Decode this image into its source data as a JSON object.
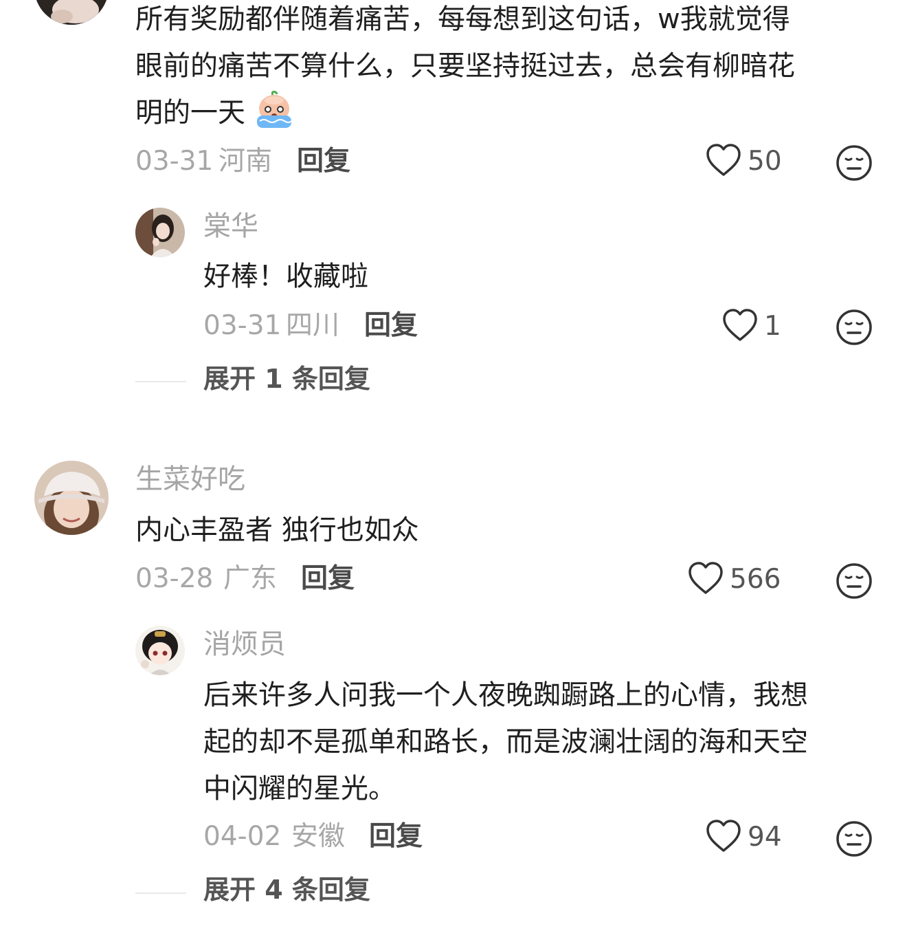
{
  "comments": [
    {
      "text_lines": [
        "所有奖励都伴随着痛苦，每每想到这句话，w我就觉得",
        "眼前的痛苦不算什么，只要坚持挺过去，总会有柳暗花",
        "明的一天"
      ],
      "emoji": "crying-face-emoji",
      "date": "03-31",
      "location": "河南",
      "reply_label": "回复",
      "likes": "50",
      "replies": [
        {
          "username": "棠华",
          "text": "好棒！收藏啦",
          "date": "03-31",
          "location": "四川",
          "reply_label": "回复",
          "likes": "1"
        }
      ],
      "expand_label": "展开 1 条回复"
    },
    {
      "username": "生菜好吃",
      "text": "内心丰盈者 独行也如众",
      "date": "03-28",
      "location": "广东",
      "reply_label": "回复",
      "likes": "566",
      "replies": [
        {
          "username": "消烦员",
          "text_lines": [
            "后来许多人问我一个人夜晚踟蹰路上的心情，我想",
            "起的却不是孤单和路长，而是波澜壮阔的海和天空",
            "中闪耀的星光。"
          ],
          "date": "04-02",
          "location": "安徽",
          "reply_label": "回复",
          "likes": "94"
        }
      ],
      "expand_label": "展开 4 条回复"
    }
  ],
  "icons": {
    "like": "heart-outline-icon",
    "dislike": "neutral-face-icon"
  }
}
